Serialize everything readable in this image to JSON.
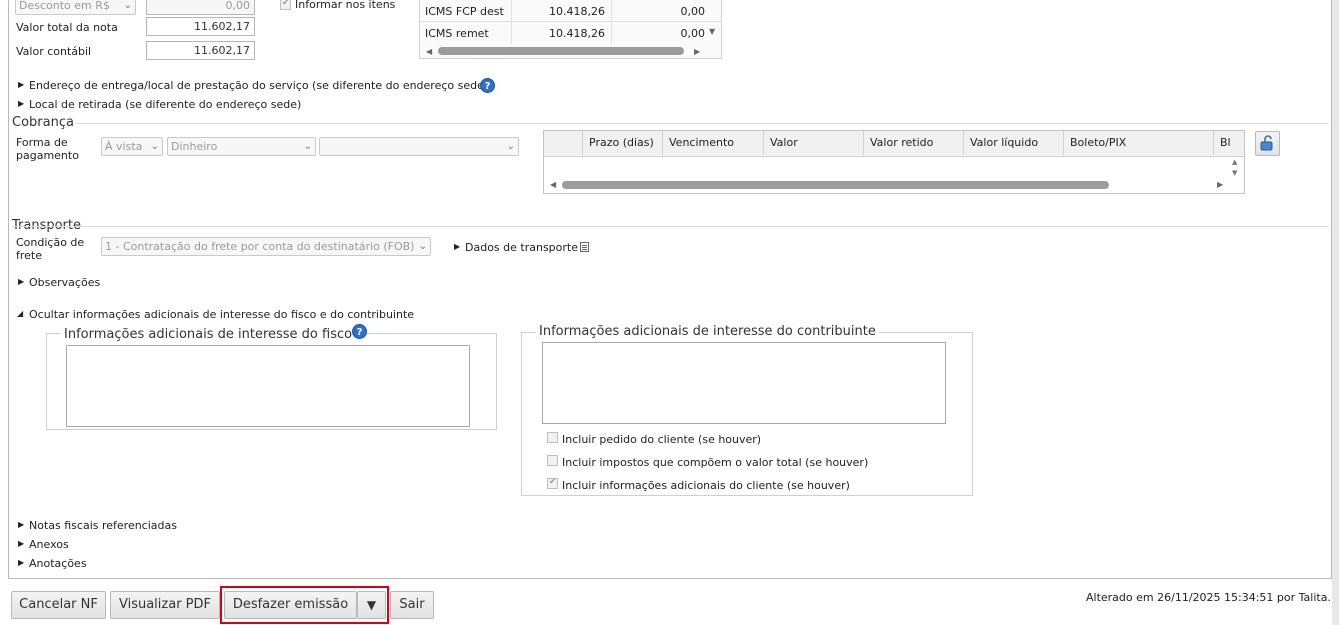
{
  "totals": {
    "discount_select": "Desconto em R$",
    "discount_value": "0,00",
    "inform_items_label": "Informar nos itens",
    "total_label": "Valor total da nota",
    "total_value": "11.602,17",
    "accounting_label": "Valor contábil",
    "accounting_value": "11.602,17"
  },
  "icms_table": {
    "rows": [
      {
        "name": "ICMS FCP dest",
        "base": "10.418,26",
        "value": "0,00"
      },
      {
        "name": "ICMS remet",
        "base": "10.418,26",
        "value": "0,00"
      }
    ]
  },
  "sections": {
    "delivery_address": "Endereço de entrega/local de prestação do serviço (se diferente do endereço sede)",
    "pickup_location": "Local de retirada (se diferente do endereço sede)"
  },
  "cobranca": {
    "title": "Cobrança",
    "payment_label_1": "Forma de",
    "payment_label_2": "pagamento",
    "payment_type": "À vista",
    "payment_method": "Dinheiro",
    "payment_extra": "",
    "columns": [
      "Prazo (dias)",
      "Vencimento",
      "Valor",
      "Valor retido",
      "Valor líquido",
      "Boleto/PIX",
      "Bl"
    ]
  },
  "transporte": {
    "title": "Transporte",
    "freight_label_1": "Condição de",
    "freight_label_2": "frete",
    "freight_value": "1 - Contratação do frete por conta do destinatário (FOB)",
    "transport_data_label": "Dados de transporte"
  },
  "observacoes": "Observações",
  "additional": {
    "toggle": "Ocultar informações adicionais de interesse do fisco e do contribuinte",
    "fisco_title": "Informações adicionais de interesse do fisco",
    "contribuinte_title": "Informações adicionais de interesse do contribuinte",
    "chk_pedido": "Incluir pedido do cliente (se houver)",
    "chk_impostos": "Incluir impostos que compõem o valor total (se houver)",
    "chk_info_cliente": "Incluir informações adicionais do cliente (se houver)"
  },
  "collapsed": {
    "notas": "Notas fiscais referenciadas",
    "anexos": "Anexos",
    "anotacoes": "Anotações"
  },
  "footer": {
    "cancel": "Cancelar NF",
    "preview": "Visualizar PDF",
    "undo": "Desfazer emissão",
    "undo_arrow": "▼",
    "exit": "Sair",
    "altered": "Alterado em 26/11/2025 15:34:51 por Talita."
  },
  "colors": {
    "accent_red": "#d6001c",
    "help_blue": "#2e6fcb"
  }
}
